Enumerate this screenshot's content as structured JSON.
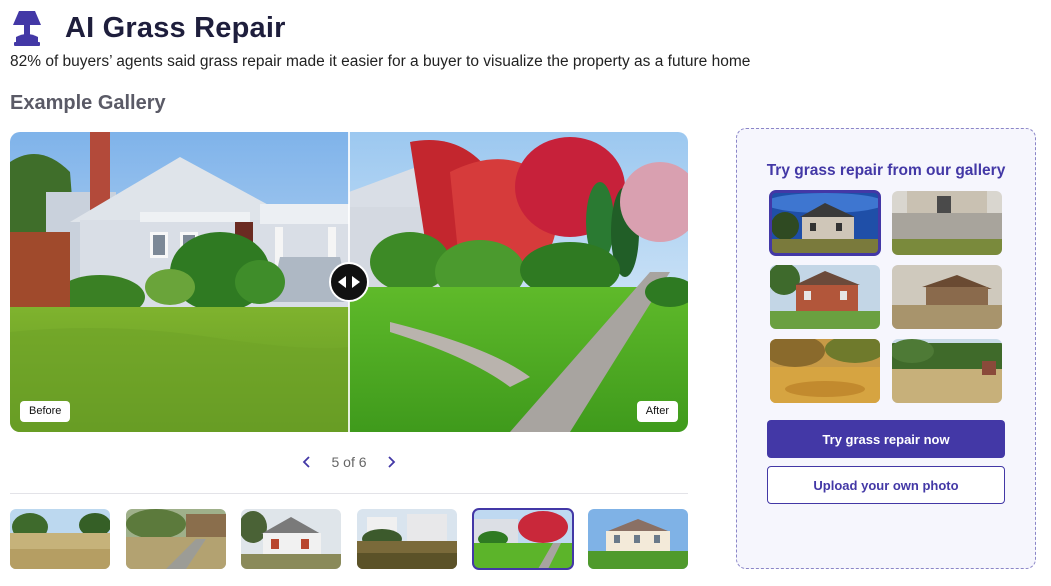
{
  "header": {
    "title": "AI Grass Repair",
    "logo_icon": "lamp-icon",
    "subtitle": "82% of buyers’ agents said grass repair made it easier for a buyer to visualize the property as a future home"
  },
  "gallery": {
    "heading": "Example Gallery",
    "before_label": "Before",
    "after_label": "After",
    "pager": {
      "current": "5 of 6",
      "prev_icon": "chevron-left-icon",
      "next_icon": "chevron-right-icon"
    },
    "active_thumbnail": 5,
    "thumbnail_count": 6
  },
  "panel": {
    "title": "Try grass repair from our gallery",
    "active_photo": 1,
    "photo_count": 6,
    "primary_button": "Try grass repair now",
    "secondary_button": "Upload your own photo"
  },
  "colors": {
    "accent": "#4338a6",
    "title_text": "#1e1e3c",
    "panel_bg": "#f6f6fd",
    "panel_border": "#8b86c8"
  }
}
